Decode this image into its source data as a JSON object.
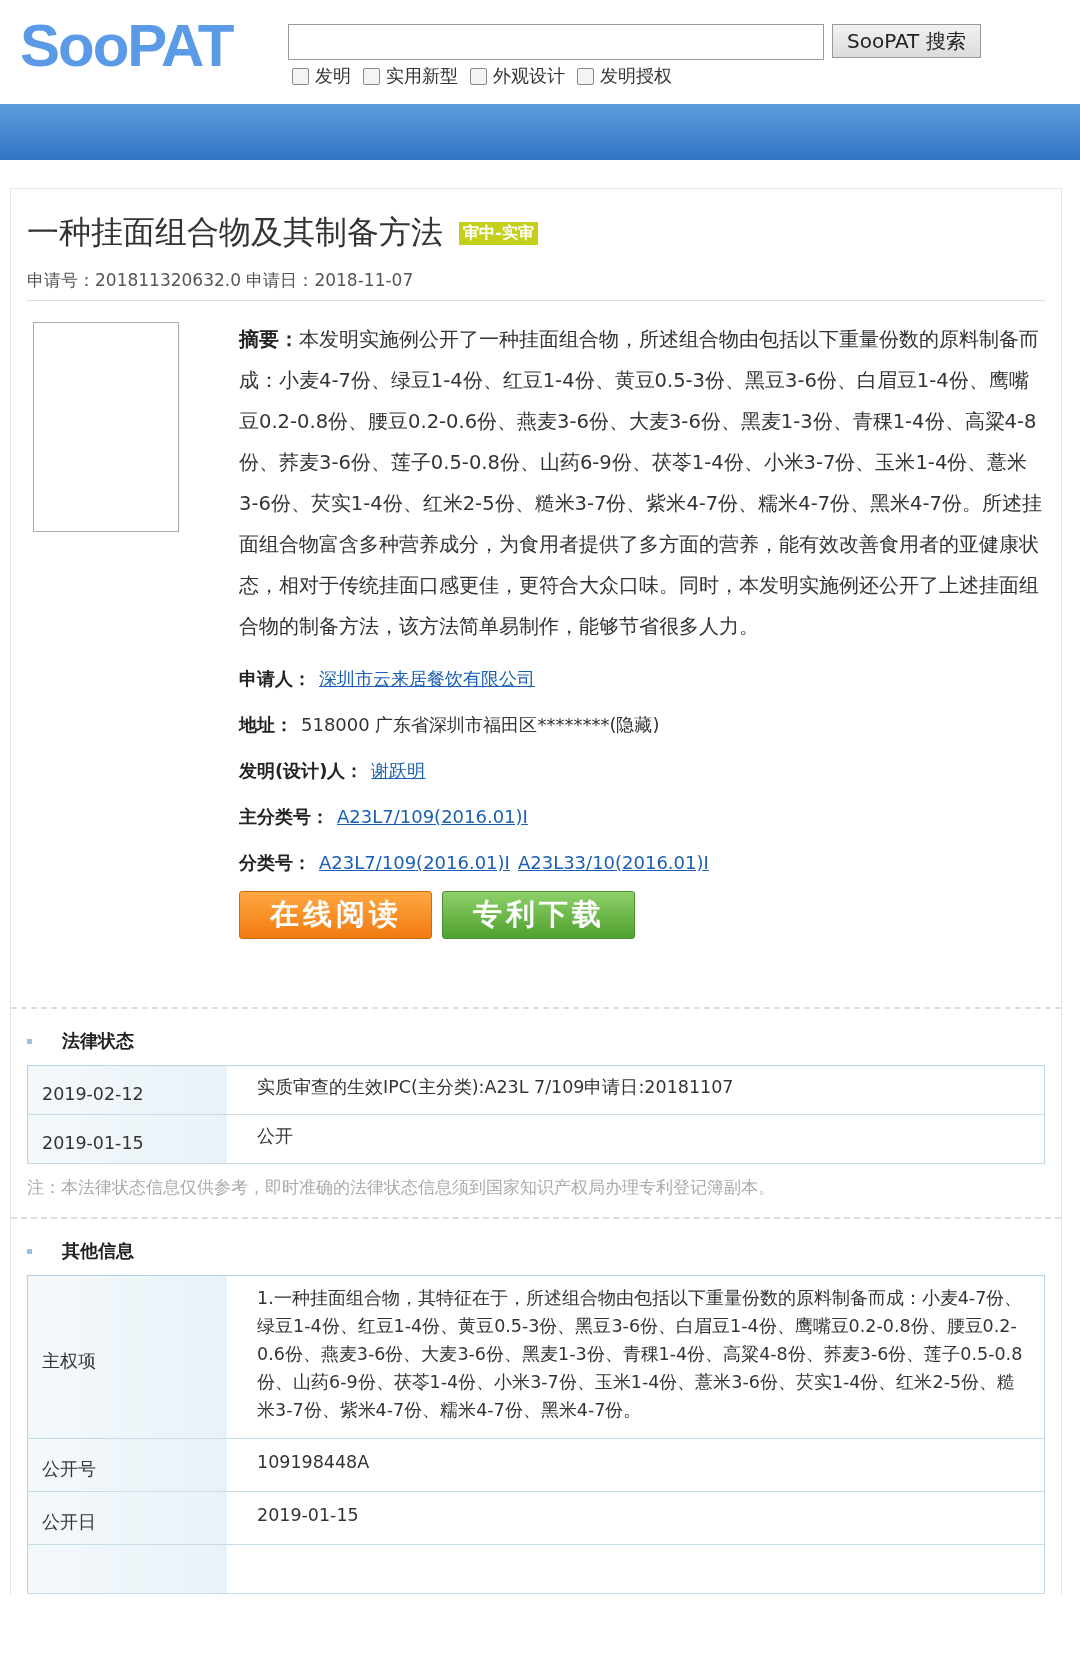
{
  "header": {
    "logo": "SooPAT",
    "search": {
      "button": "SooPAT 搜索"
    },
    "filters": [
      {
        "label": "发明",
        "checked": false
      },
      {
        "label": "实用新型",
        "checked": false
      },
      {
        "label": "外观设计",
        "checked": false
      },
      {
        "label": "发明授权",
        "checked": false
      }
    ]
  },
  "patent": {
    "title": "一种挂面组合物及其制备方法",
    "status_badge": "审中-实审",
    "application_line": "申请号：201811320632.0 申请日：2018-11-07",
    "abstract": {
      "label": "摘要：",
      "text": "本发明实施例公开了一种挂面组合物，所述组合物由包括以下重量份数的原料制备而成：小麦4-7份、绿豆1-4份、红豆1-4份、黄豆0.5-3份、黑豆3-6份、白眉豆1-4份、鹰嘴豆0.2-0.8份、腰豆0.2-0.6份、燕麦3-6份、大麦3-6份、黑麦1-3份、青稞1-4份、高粱4-8份、荞麦3-6份、莲子0.5-0.8份、山药6-9份、茯苓1-4份、小米3-7份、玉米1-4份、薏米3-6份、芡实1-4份、红米2-5份、糙米3-7份、紫米4-7份、糯米4-7份、黑米4-7份。所述挂面组合物富含多种营养成分，为食用者提供了多方面的营养，能有效改善食用者的亚健康状态，相对于传统挂面口感更佳，更符合大众口味。同时，本发明实施例还公开了上述挂面组合物的制备方法，该方法简单易制作，能够节省很多人力。"
    },
    "fields": [
      {
        "label": "申请人：",
        "values": [
          {
            "text": "深圳市云来居餐饮有限公司",
            "kind": "link"
          }
        ]
      },
      {
        "label": "地址：",
        "values": [
          {
            "text": "518000 广东省深圳市福田区********(隐藏)",
            "kind": "text"
          }
        ]
      },
      {
        "label": "发明(设计)人：",
        "values": [
          {
            "text": "谢跃明",
            "kind": "link"
          }
        ]
      },
      {
        "label": "主分类号：",
        "values": [
          {
            "text": "A23L7/109(2016.01)I",
            "kind": "link"
          }
        ]
      },
      {
        "label": "分类号：",
        "values": [
          {
            "text": "A23L7/109(2016.01)I",
            "kind": "link"
          },
          {
            "text": "A23L33/10(2016.01)I",
            "kind": "link"
          }
        ]
      }
    ],
    "buttons": [
      {
        "label": "在线阅读",
        "kind": "orange"
      },
      {
        "label": "专利下载",
        "kind": "green"
      }
    ]
  },
  "legal_status": {
    "heading": "法律状态",
    "rows": [
      {
        "date": "2019-02-12",
        "event": "实质审查的生效IPC(主分类):A23L 7/109申请日:20181107"
      },
      {
        "date": "2019-01-15",
        "event": "公开"
      }
    ],
    "note": "注：本法律状态信息仅供参考，即时准确的法律状态信息须到国家知识产权局办理专利登记簿副本。"
  },
  "other_info": {
    "heading": "其他信息",
    "rows": [
      {
        "label": "主权项",
        "value": "1.一种挂面组合物，其特征在于，所述组合物由包括以下重量份数的原料制备而成：小麦4-7份、绿豆1-4份、红豆1-4份、黄豆0.5-3份、黑豆3-6份、白眉豆1-4份、鹰嘴豆0.2-0.8份、腰豆0.2-0.6份、燕麦3-6份、大麦3-6份、黑麦1-3份、青稞1-4份、高粱4-8份、荞麦3-6份、莲子0.5-0.8份、山药6-9份、茯苓1-4份、小米3-7份、玉米1-4份、薏米3-6份、芡实1-4份、红米2-5份、糙米3-7份、紫米4-7份、糯米4-7份、黑米4-7份。"
      },
      {
        "label": "公开号",
        "value": "109198448A"
      },
      {
        "label": "公开日",
        "value": "2019-01-15"
      }
    ]
  }
}
